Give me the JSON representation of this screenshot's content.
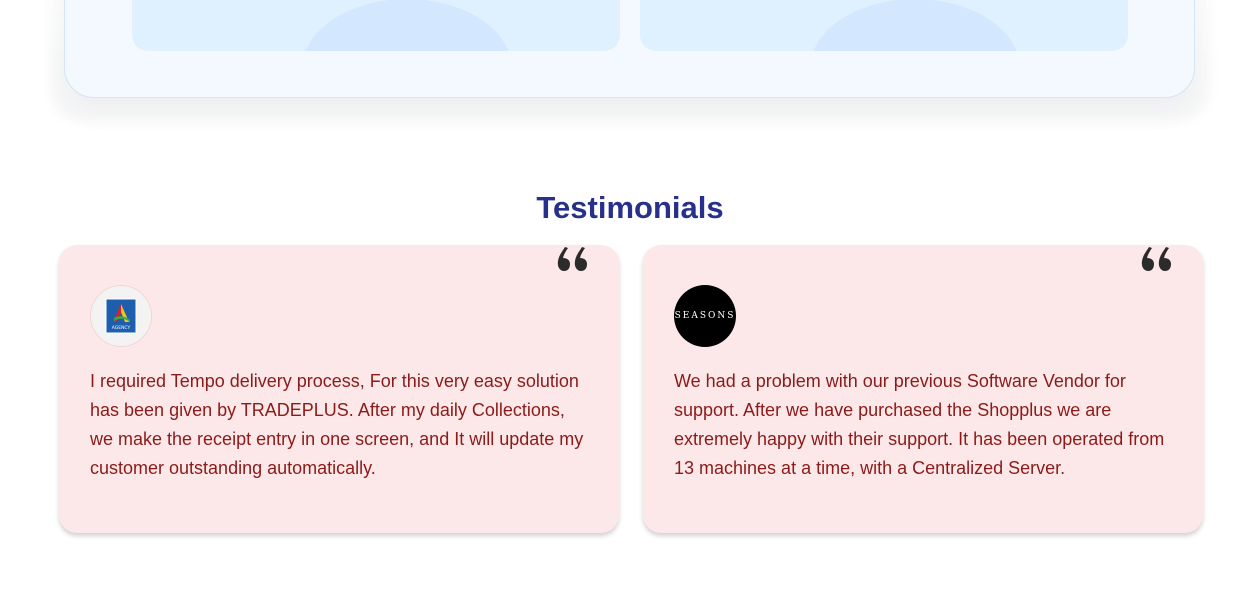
{
  "colors": {
    "title": "#27308a",
    "card_background": "#fce8e8",
    "card_text": "#8c1a1a",
    "top_card_background": "#f4f9ff",
    "preview_panel": "#dff0ff"
  },
  "section": {
    "title": "Testimonials"
  },
  "testimonials": [
    {
      "logo_icon": "agency-logo",
      "logo_text": "AGENCY",
      "quote_icon": "quote-icon",
      "text": "I required Tempo delivery process, For this very easy solution has been given by TRADEPLUS. After my daily Collections, we make the receipt entry in one screen, and It will update my customer outstanding automatically."
    },
    {
      "logo_icon": "seasons-logo",
      "logo_text": "SEASONS",
      "quote_icon": "quote-icon",
      "text": "We had a problem with our previous Software Vendor for support. After we have purchased the Shopplus we are extremely happy with their support. It has been operated from 13 machines at a time, with a Centralized Server."
    }
  ]
}
